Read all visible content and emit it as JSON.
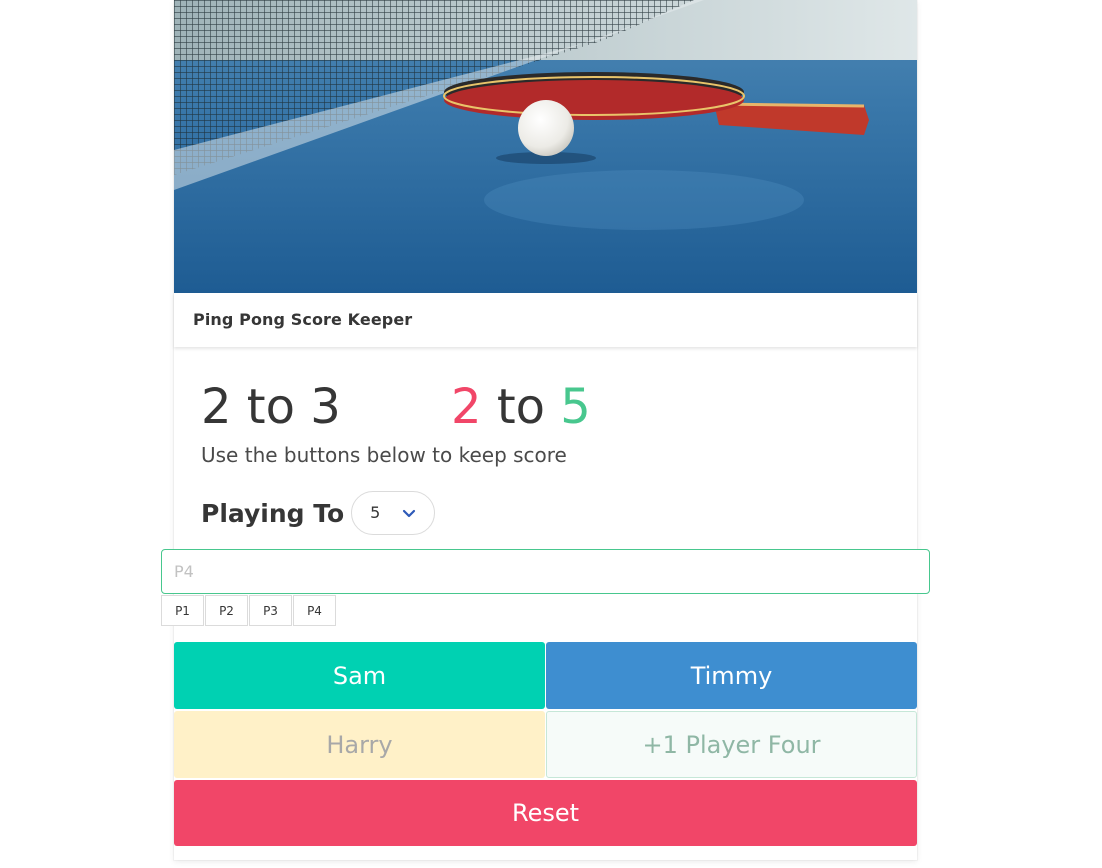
{
  "header": {
    "title": "Ping Pong Score Keeper"
  },
  "scores": {
    "left": "2 to 3",
    "right_p1": "2",
    "right_sep": "to",
    "right_p2": "5",
    "subtitle": "Use the buttons below to keep score"
  },
  "playing_to": {
    "label": "Playing To",
    "selected": "5"
  },
  "name_input": {
    "placeholder": "P4",
    "value": ""
  },
  "player_tabs": [
    "P1",
    "P2",
    "P3",
    "P4"
  ],
  "buttons": {
    "p1": "Sam",
    "p2": "Timmy",
    "p3": "Harry",
    "p4": "+1 Player Four",
    "reset": "Reset"
  },
  "colors": {
    "red": "#f14668",
    "green": "#48c78e",
    "turquoise": "#00d1b2",
    "blue": "#3e8ed0",
    "warning_light": "#fff1c8"
  },
  "icons": {
    "select_arrow": "chevron-down-icon"
  }
}
